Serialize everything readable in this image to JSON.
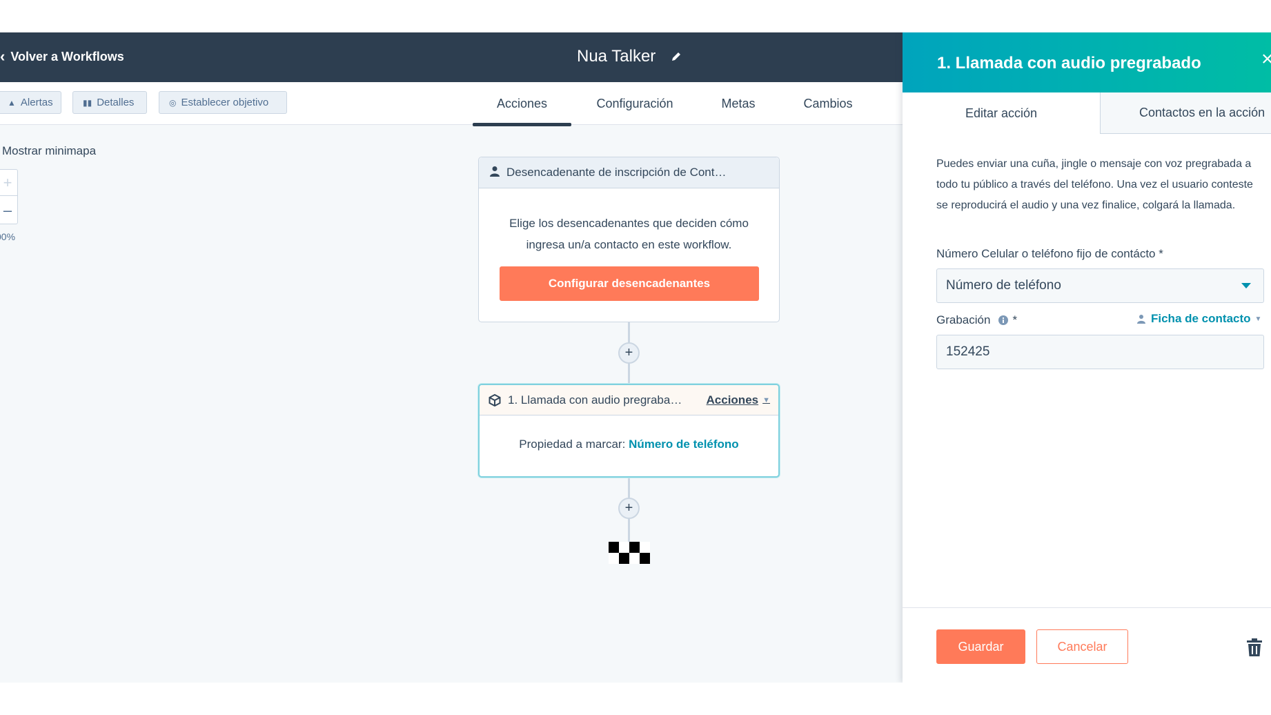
{
  "header": {
    "back_label": "Volver a Workflows",
    "title": "Nua Talker"
  },
  "toolbar": {
    "alerts_label": "Alertas",
    "details_label": "Detalles",
    "goal_label": "Establecer objetivo",
    "tabs": [
      {
        "label": "Acciones",
        "active": true
      },
      {
        "label": "Configuración",
        "active": false
      },
      {
        "label": "Metas",
        "active": false
      },
      {
        "label": "Cambios",
        "active": false
      }
    ]
  },
  "canvas": {
    "minimap_label": "Mostrar minimapa",
    "zoom_in": "+",
    "zoom_out": "–",
    "zoom_level": "00%",
    "trigger_card": {
      "title": "Desencadenante de inscripción de Cont…",
      "description": "Elige los desencadenantes que deciden cómo ingresa un/a contacto en este workflow.",
      "button_label": "Configurar desencadenantes"
    },
    "action_card": {
      "title": "1. Llamada con audio pregraba…",
      "menu_label": "Acciones",
      "property_label": "Propiedad a marcar:",
      "property_value": "Número de teléfono"
    },
    "plus_label": "+"
  },
  "panel": {
    "title": "1. Llamada con audio pregrabado",
    "close": "×",
    "tabs": {
      "edit": "Editar acción",
      "contacts": "Contactos en la acción"
    },
    "description": "Puedes enviar una cuña, jingle o mensaje con voz pregrabada a todo tu público a través del teléfono. Una vez el usuario conteste se reproducirá el audio y una vez finalice, colgará la llamada.",
    "phone_field": {
      "label": "Número Celular o teléfono fijo de contácto *",
      "value": "Número de teléfono"
    },
    "recording_field": {
      "label": "Grabación",
      "required_mark": "*",
      "contact_card_label": "Ficha de contacto",
      "value": "152425"
    },
    "footer": {
      "save_label": "Guardar",
      "cancel_label": "Cancelar"
    }
  },
  "colors": {
    "header_bg": "#2d3e50",
    "accent_orange": "#ff7a59",
    "teal_link": "#0091ae",
    "panel_header_start": "#00a4bd",
    "panel_header_end": "#00bda5",
    "canvas_bg": "#f5f8fa"
  }
}
